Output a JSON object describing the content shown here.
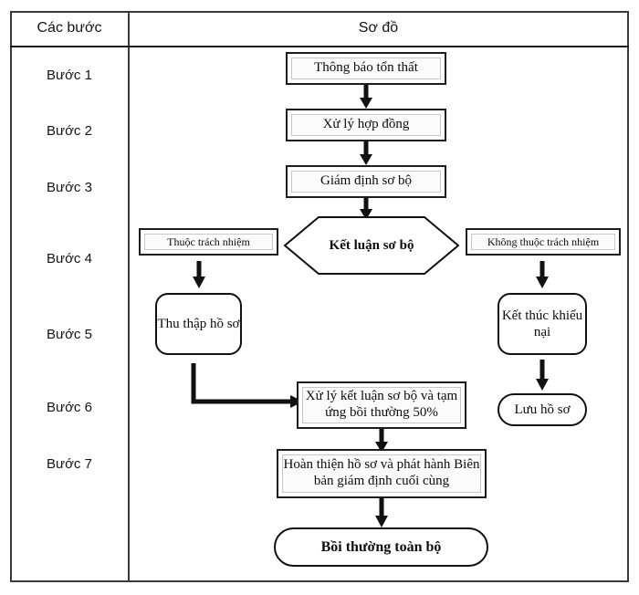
{
  "table": {
    "headers": {
      "steps": "Các bước",
      "diagram": "Sơ đồ"
    },
    "steps": [
      {
        "label": "Bước 1"
      },
      {
        "label": "Bước 2"
      },
      {
        "label": "Bước 3"
      },
      {
        "label": "Bước 4"
      },
      {
        "label": "Bước 5"
      },
      {
        "label": "Bước 6"
      },
      {
        "label": "Bước 7"
      }
    ]
  },
  "flowchart": {
    "nodes": {
      "notify_loss": "Thông báo tổn thất",
      "process_contract": "Xử lý hợp đồng",
      "preliminary_survey": "Giám định sơ bộ",
      "decision": "Kết luận sơ bộ",
      "branch_liable": "Thuộc trách nhiệm",
      "branch_not_liable": "Không thuộc trách nhiệm",
      "collect_documents": "Thu thập hồ sơ",
      "end_claim": "Kết thúc khiếu nại",
      "archive_file": "Lưu hồ sơ",
      "process_advance": "Xử lý kết luận sơ bộ và tạm ứng bồi thường 50%",
      "finalize_report": "Hoàn thiện hồ sơ và phát hành Biên bản giám định cuối cùng",
      "full_compensation": "Bồi thường toàn bộ"
    },
    "colors": {
      "border": "#1d1d1d",
      "inner_border": "#c8c8c8",
      "arrow": "#111111",
      "background": "#ffffff",
      "text": "#0d0d0d"
    }
  }
}
